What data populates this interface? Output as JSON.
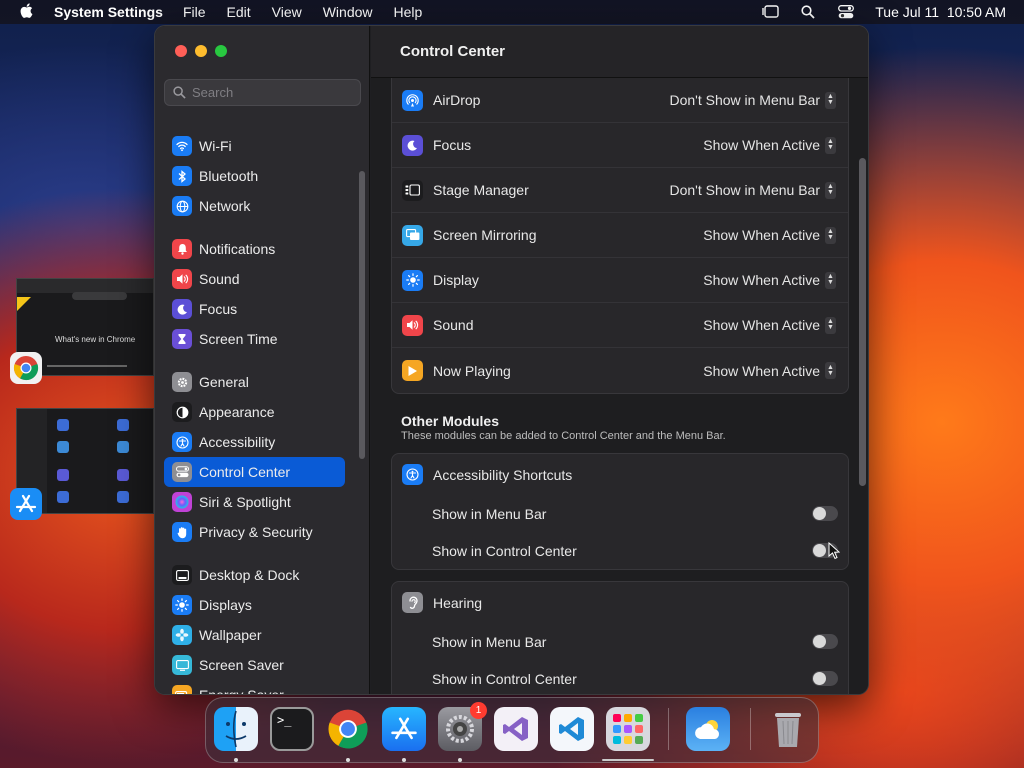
{
  "menubar": {
    "app_name": "System Settings",
    "menus": [
      "File",
      "Edit",
      "View",
      "Window",
      "Help"
    ],
    "clock": "Tue Jul 11  10:50 AM"
  },
  "sidebar": {
    "search_placeholder": "Search",
    "groups": [
      [
        {
          "label": "Wi-Fi",
          "icon": "wifi-icon",
          "color": "#1a7cf5"
        },
        {
          "label": "Bluetooth",
          "icon": "bluetooth-icon",
          "color": "#1a7cf5"
        },
        {
          "label": "Network",
          "icon": "globe-icon",
          "color": "#1a7cf5"
        }
      ],
      [
        {
          "label": "Notifications",
          "icon": "bell-icon",
          "color": "#f0454a"
        },
        {
          "label": "Sound",
          "icon": "speaker-icon",
          "color": "#f0454a"
        },
        {
          "label": "Focus",
          "icon": "moon-icon",
          "color": "#5b4fd6"
        },
        {
          "label": "Screen Time",
          "icon": "hourglass-icon",
          "color": "#6a4fd6"
        }
      ],
      [
        {
          "label": "General",
          "icon": "gear-icon",
          "color": "#8e8e93"
        },
        {
          "label": "Appearance",
          "icon": "appearance-icon",
          "color": "#1c1c1e"
        },
        {
          "label": "Accessibility",
          "icon": "accessibility-icon",
          "color": "#1a7cf5"
        },
        {
          "label": "Control Center",
          "icon": "toggles-icon",
          "color": "#8e8e93",
          "active": true
        },
        {
          "label": "Siri & Spotlight",
          "icon": "siri-icon",
          "color": "#c042d6"
        },
        {
          "label": "Privacy & Security",
          "icon": "hand-icon",
          "color": "#1a7cf5"
        }
      ],
      [
        {
          "label": "Desktop & Dock",
          "icon": "dock-icon",
          "color": "#1c1c1e"
        },
        {
          "label": "Displays",
          "icon": "sun-icon",
          "color": "#1a7cf5"
        },
        {
          "label": "Wallpaper",
          "icon": "flower-icon",
          "color": "#2fb0e8"
        },
        {
          "label": "Screen Saver",
          "icon": "screensaver-icon",
          "color": "#36b8d8"
        },
        {
          "label": "Energy Saver",
          "icon": "battery-icon",
          "color": "#f5a623"
        }
      ]
    ]
  },
  "main": {
    "title": "Control Center",
    "modules": [
      {
        "label": "AirDrop",
        "icon": "airdrop-icon",
        "color": "#1a7cf5",
        "value": "Don't Show in Menu Bar"
      },
      {
        "label": "Focus",
        "icon": "moon-icon",
        "color": "#5b4fd6",
        "value": "Show When Active"
      },
      {
        "label": "Stage Manager",
        "icon": "stage-manager-icon",
        "color": "#1c1c1e",
        "value": "Don't Show in Menu Bar"
      },
      {
        "label": "Screen Mirroring",
        "icon": "screen-mirroring-icon",
        "color": "#36a8e8",
        "value": "Show When Active"
      },
      {
        "label": "Display",
        "icon": "sun-icon",
        "color": "#1a7cf5",
        "value": "Show When Active"
      },
      {
        "label": "Sound",
        "icon": "speaker-icon",
        "color": "#f0454a",
        "value": "Show When Active"
      },
      {
        "label": "Now Playing",
        "icon": "play-icon",
        "color": "#f5a623",
        "value": "Show When Active"
      }
    ],
    "other_title": "Other Modules",
    "other_subtitle": "These modules can be added to Control Center and the Menu Bar.",
    "other_modules": [
      {
        "label": "Accessibility Shortcuts",
        "icon": "accessibility-icon",
        "color": "#1a7cf5",
        "options": [
          {
            "label": "Show in Menu Bar",
            "on": false
          },
          {
            "label": "Show in Control Center",
            "on": false
          }
        ]
      },
      {
        "label": "Hearing",
        "icon": "ear-icon",
        "color": "#8e8e93",
        "options": [
          {
            "label": "Show in Menu Bar",
            "on": false
          },
          {
            "label": "Show in Control Center",
            "on": false
          }
        ]
      }
    ]
  },
  "ghost_window": {
    "text": "What's new in Chrome"
  },
  "dock": {
    "apps": [
      "finder-icon",
      "terminal-icon",
      "chrome-icon",
      "app-store-icon",
      "system-settings-icon",
      "visual-studio-icon",
      "vscode-icon",
      "launchpad-icon",
      "weather-icon",
      "trash-icon"
    ],
    "settings_badge": "1"
  }
}
